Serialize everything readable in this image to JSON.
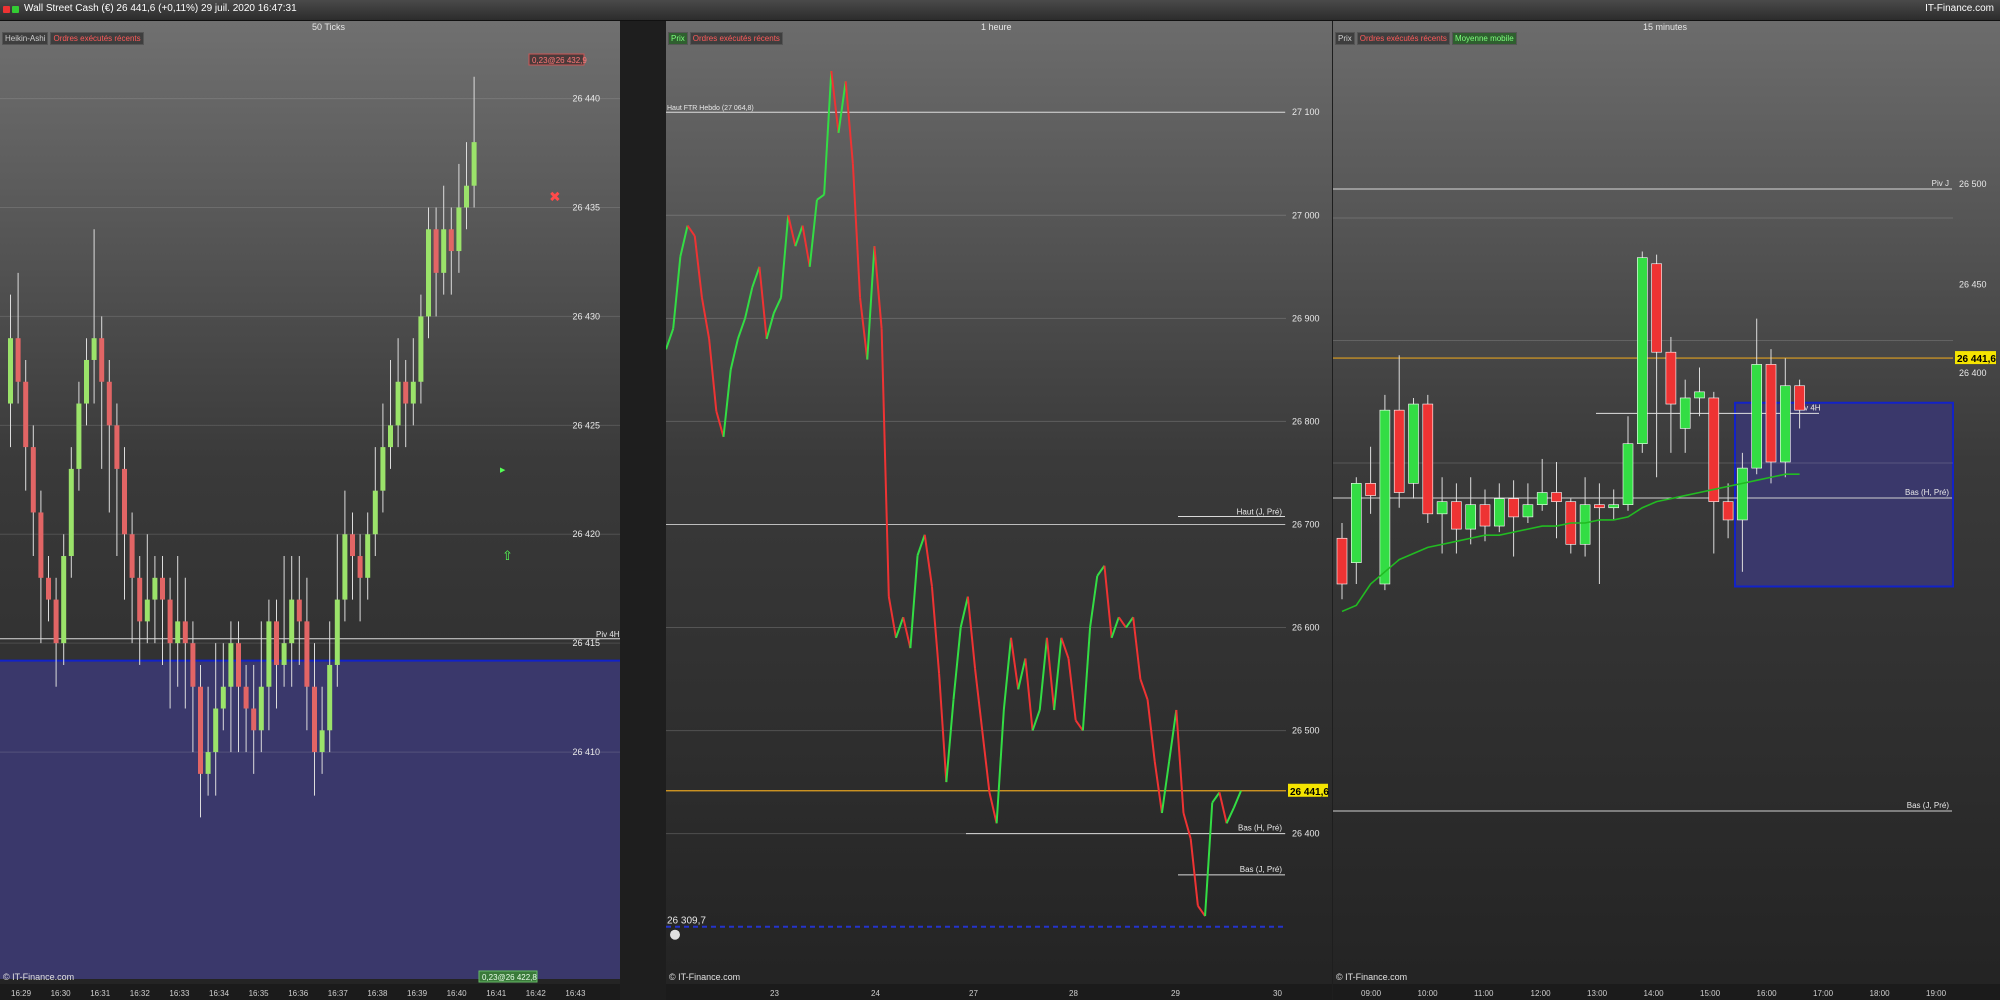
{
  "app": {
    "title": "Wall Street Cash (€)   26 441,6 (+0,11%)   29 juil. 2020 16:47:31",
    "brand": "IT-Finance.com"
  },
  "copyright": "© IT-Finance.com",
  "colors": {
    "up": "#33dd44",
    "down": "#ee3333",
    "ha_up": "#9be36a",
    "ha_down": "#e26565",
    "zone": "#3a386b",
    "zone_border": "#1222c8",
    "price_line": "#e0a020",
    "price_tag": "#f5e400",
    "ma_line": "#22bb22"
  },
  "panels": [
    {
      "id": "ticks",
      "title": "50 Ticks",
      "legend": [
        "Heikin-Ashi",
        "Ordres exécutés récents"
      ],
      "top_tag": "0,23@26 432,9",
      "bottom_tag": "0,23@26 422,8",
      "price_labels": [
        "26 440",
        "26 435",
        "26 430",
        "26 425",
        "26 420",
        "26 415",
        "26 410"
      ],
      "line_labels": [
        "Piv 4H"
      ],
      "time_labels": [
        "16:29",
        "16:30",
        "16:31",
        "16:32",
        "16:33",
        "16:34",
        "16:35",
        "16:36",
        "16:37",
        "16:38",
        "16:39",
        "16:40",
        "16:41",
        "16:42",
        "16:43"
      ]
    },
    {
      "id": "hourly",
      "title": "1 heure",
      "legend": [
        "Prix",
        "Ordres exécutés récents"
      ],
      "top_left_label": "Haut FTR Hebdo (27 064,8)",
      "bottom_left_value": "26 309,7",
      "price_labels": [
        "27 100",
        "27 000",
        "26 900",
        "26 800",
        "26 700",
        "26 600",
        "26 500",
        "26 400"
      ],
      "current_price": "26 441,6",
      "line_labels": [
        "Haut (J, Pré)",
        "Bas (H, Pré)",
        "Bas (J, Pré)"
      ],
      "time_labels": [
        "23",
        "24",
        "27",
        "28",
        "29",
        "30"
      ]
    },
    {
      "id": "fifteen",
      "title": "15 minutes",
      "legend": [
        "Prix",
        "Ordres exécutés récents",
        "Moyenne mobile"
      ],
      "price_labels": [
        "26 500",
        "26 450",
        "26 400"
      ],
      "current_price": "26 441,6",
      "line_labels": [
        "Piv J",
        "Piv 4H",
        "Bas (H, Pré)",
        "Bas (J, Pré)"
      ],
      "time_labels": [
        "09:00",
        "10:00",
        "11:00",
        "12:00",
        "13:00",
        "14:00",
        "15:00",
        "16:00",
        "17:00",
        "18:00",
        "19:00"
      ]
    }
  ],
  "chart_data": [
    {
      "type": "candlestick",
      "title": "50 Ticks",
      "style": "Heikin-Ashi",
      "ylim": [
        26405,
        26442
      ],
      "candles": [
        [
          26426,
          26429,
          26431,
          26424
        ],
        [
          26429,
          26427,
          26432,
          26426
        ],
        [
          26427,
          26424,
          26428,
          26422
        ],
        [
          26424,
          26421,
          26425,
          26419
        ],
        [
          26421,
          26418,
          26422,
          26415
        ],
        [
          26418,
          26417,
          26419,
          26416
        ],
        [
          26417,
          26415,
          26418,
          26413
        ],
        [
          26415,
          26419,
          26420,
          26414
        ],
        [
          26419,
          26423,
          26424,
          26418
        ],
        [
          26423,
          26426,
          26427,
          26422
        ],
        [
          26426,
          26428,
          26429,
          26425
        ],
        [
          26428,
          26429,
          26434,
          26426
        ],
        [
          26429,
          26427,
          26430,
          26423
        ],
        [
          26427,
          26425,
          26428,
          26421
        ],
        [
          26425,
          26423,
          26426,
          26419
        ],
        [
          26423,
          26420,
          26424,
          26417
        ],
        [
          26420,
          26418,
          26421,
          26415
        ],
        [
          26418,
          26416,
          26419,
          26414
        ],
        [
          26416,
          26417,
          26420,
          26415
        ],
        [
          26417,
          26418,
          26419,
          26415
        ],
        [
          26418,
          26417,
          26419,
          26414
        ],
        [
          26417,
          26415,
          26418,
          26412
        ],
        [
          26415,
          26416,
          26419,
          26413
        ],
        [
          26416,
          26415,
          26418,
          26412
        ],
        [
          26415,
          26413,
          26416,
          26410
        ],
        [
          26413,
          26409,
          26414,
          26407
        ],
        [
          26409,
          26410,
          26413,
          26408
        ],
        [
          26410,
          26412,
          26415,
          26408
        ],
        [
          26412,
          26413,
          26415,
          26411
        ],
        [
          26413,
          26415,
          26416,
          26410
        ],
        [
          26415,
          26413,
          26416,
          26410
        ],
        [
          26413,
          26412,
          26414,
          26410
        ],
        [
          26412,
          26411,
          26414,
          26409
        ],
        [
          26411,
          26413,
          26416,
          26410
        ],
        [
          26413,
          26416,
          26417,
          26411
        ],
        [
          26416,
          26414,
          26417,
          26412
        ],
        [
          26414,
          26415,
          26419,
          26413
        ],
        [
          26415,
          26417,
          26419,
          26413
        ],
        [
          26417,
          26416,
          26419,
          26414
        ],
        [
          26416,
          26413,
          26418,
          26411
        ],
        [
          26413,
          26410,
          26415,
          26408
        ],
        [
          26410,
          26411,
          26413,
          26409
        ],
        [
          26411,
          26414,
          26416,
          26410
        ],
        [
          26414,
          26417,
          26420,
          26413
        ],
        [
          26417,
          26420,
          26422,
          26416
        ],
        [
          26420,
          26419,
          26421,
          26417
        ],
        [
          26419,
          26418,
          26420,
          26416
        ],
        [
          26418,
          26420,
          26421,
          26417
        ],
        [
          26420,
          26422,
          26424,
          26419
        ],
        [
          26422,
          26424,
          26426,
          26421
        ],
        [
          26424,
          26425,
          26428,
          26423
        ],
        [
          26425,
          26427,
          26429,
          26424
        ],
        [
          26427,
          26426,
          26428,
          26424
        ],
        [
          26426,
          26427,
          26429,
          26425
        ],
        [
          26427,
          26430,
          26431,
          26426
        ],
        [
          26430,
          26434,
          26435,
          26429
        ],
        [
          26434,
          26432,
          26435,
          26430
        ],
        [
          26432,
          26434,
          26436,
          26431
        ],
        [
          26434,
          26433,
          26435,
          26431
        ],
        [
          26433,
          26435,
          26437,
          26432
        ],
        [
          26435,
          26436,
          26438,
          26434
        ],
        [
          26436,
          26438,
          26441,
          26435
        ]
      ],
      "markers": [
        {
          "type": "cross",
          "value": 26435.5
        },
        {
          "type": "arrow-up",
          "value": 26419
        },
        {
          "type": "triangle",
          "value": 26423
        }
      ],
      "levels": [
        {
          "name": "Piv 4H",
          "value": 26415.2
        }
      ],
      "zone": {
        "from": 26404,
        "to": 26414.2
      }
    },
    {
      "type": "line",
      "title": "1 heure",
      "ylim": [
        26290,
        27140
      ],
      "x_ticks": [
        "23",
        "24",
        "27",
        "28",
        "29",
        "30"
      ],
      "series": [
        {
          "values": [
            26870,
            26890,
            26960,
            26990,
            26980,
            26920,
            26880,
            26810,
            26785,
            26850,
            26880,
            26900,
            26930,
            26950,
            26880,
            26905,
            26920,
            27000,
            26970,
            26990,
            26950,
            27015,
            27020,
            27140,
            27080,
            27130,
            27050,
            26920,
            26860,
            26970,
            26890,
            26630,
            26590,
            26610,
            26580,
            26670,
            26690,
            26640,
            26555,
            26450,
            26530,
            26600,
            26630,
            26560,
            26500,
            26440,
            26410,
            26520,
            26590,
            26540,
            26570,
            26500,
            26520,
            26590,
            26520,
            26590,
            26570,
            26510,
            26500,
            26600,
            26650,
            26660,
            26590,
            26610,
            26600,
            26610,
            26550,
            26530,
            26470,
            26420,
            26470,
            26520,
            26420,
            26395,
            26330,
            26320,
            26430,
            26440,
            26410,
            26425,
            26441.6
          ],
          "colors_by_direction": true
        }
      ],
      "levels": [
        {
          "name": "Haut FTR Hebdo",
          "value": 27100
        },
        {
          "name": "Haut (J, Pré)",
          "value": 26700
        },
        {
          "name": "Bas (H, Pré)",
          "value": 26400
        },
        {
          "name": "Bas (J, Pré)",
          "value": 26360
        },
        {
          "name": "current",
          "value": 26441.6
        },
        {
          "name": "dashed",
          "value": 26309.7
        }
      ]
    },
    {
      "type": "candlestick",
      "title": "15 minutes",
      "ylim": [
        26340,
        26540
      ],
      "x_ticks": [
        "09:00",
        "10:00",
        "11:00",
        "12:00",
        "13:00",
        "14:00",
        "15:00",
        "16:00",
        "17:00",
        "18:00",
        "19:00"
      ],
      "candles": [
        [
          26400,
          26385,
          26405,
          26380
        ],
        [
          26392,
          26418,
          26420,
          26385
        ],
        [
          26418,
          26414,
          26430,
          26408
        ],
        [
          26385,
          26442,
          26447,
          26383
        ],
        [
          26442,
          26415,
          26460,
          26410
        ],
        [
          26418,
          26444,
          26446,
          26413
        ],
        [
          26444,
          26408,
          26447,
          26405
        ],
        [
          26408,
          26412,
          26420,
          26395
        ],
        [
          26412,
          26403,
          26418,
          26395
        ],
        [
          26403,
          26411,
          26420,
          26398
        ],
        [
          26411,
          26404,
          26416,
          26399
        ],
        [
          26404,
          26413,
          26418,
          26402
        ],
        [
          26413,
          26407,
          26419,
          26394
        ],
        [
          26407,
          26411,
          26418,
          26405
        ],
        [
          26411,
          26415,
          26426,
          26409
        ],
        [
          26415,
          26412,
          26425,
          26400
        ],
        [
          26412,
          26398,
          26413,
          26395
        ],
        [
          26398,
          26411,
          26420,
          26394
        ],
        [
          26411,
          26410,
          26418,
          26385
        ],
        [
          26410,
          26411,
          26416,
          26406
        ],
        [
          26411,
          26431,
          26440,
          26409
        ],
        [
          26431,
          26492,
          26494,
          26428
        ],
        [
          26490,
          26461,
          26493,
          26420
        ],
        [
          26461,
          26444,
          26466,
          26428
        ],
        [
          26436,
          26446,
          26452,
          26428
        ],
        [
          26446,
          26448,
          26456,
          26440
        ],
        [
          26446,
          26412,
          26448,
          26395
        ],
        [
          26412,
          26406,
          26418,
          26400
        ],
        [
          26406,
          26423,
          26428,
          26389
        ],
        [
          26423,
          26457,
          26472,
          26421
        ],
        [
          26457,
          26425,
          26462,
          26418
        ],
        [
          26425,
          26450,
          26459,
          26420
        ],
        [
          26450,
          26442,
          26452,
          26436
        ]
      ],
      "moving_average": [
        26376,
        26378,
        26385,
        26389,
        26393,
        26395,
        26397,
        26398,
        26399,
        26400,
        26401,
        26401,
        26402,
        26403,
        26404,
        26404,
        26405,
        26405,
        26406,
        26406,
        26407,
        26410,
        26412,
        26413,
        26414,
        26415,
        26416,
        26417,
        26418,
        26419,
        26420,
        26421,
        26421
      ],
      "levels": [
        {
          "name": "Piv J",
          "value": 26500
        },
        {
          "name": "Piv 4H",
          "value": 26428
        },
        {
          "name": "Bas (H, Pré)",
          "value": 26400
        },
        {
          "name": "Bas (J, Pré)",
          "value": 26349
        },
        {
          "name": "current",
          "value": 26441.6
        }
      ],
      "zone": {
        "from": 26350,
        "to": 26425
      }
    }
  ]
}
